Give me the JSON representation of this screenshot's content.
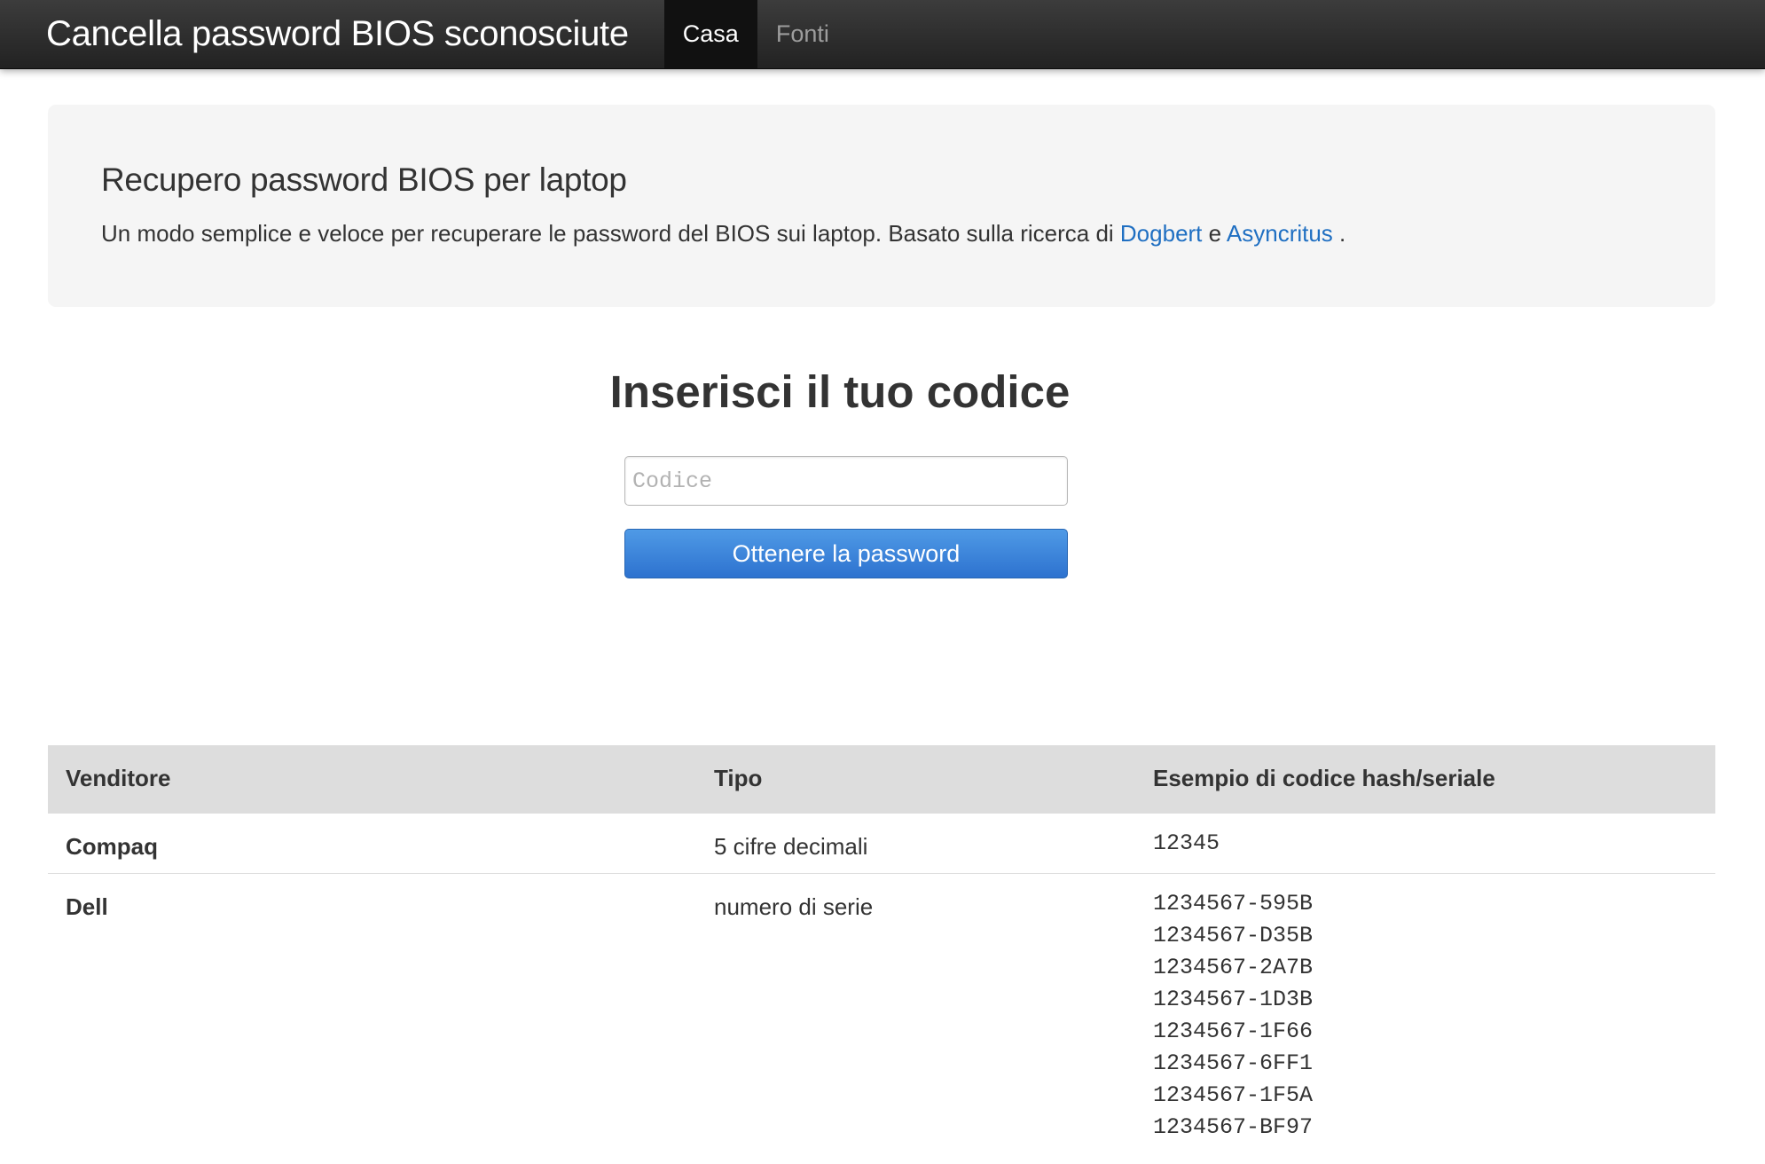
{
  "navbar": {
    "brand": "Cancella password BIOS sconosciute",
    "items": [
      {
        "label": "Casa",
        "active": true
      },
      {
        "label": "Fonti",
        "active": false
      }
    ]
  },
  "hero": {
    "title": "Recupero password BIOS per laptop",
    "text_before": "Un modo semplice e veloce per recuperare le password del BIOS sui laptop. Basato sulla ricerca di ",
    "link1": "Dogbert",
    "text_between": " e ",
    "link2": "Asyncritus",
    "text_after": " .",
    "link_color": "#1f6fc2"
  },
  "form": {
    "heading": "Inserisci il tuo codice",
    "input_placeholder": "Codice",
    "input_value": "",
    "button_label": "Ottenere la password",
    "button_color": "#3a82d9"
  },
  "table": {
    "headers": [
      "Venditore",
      "Tipo",
      "Esempio di codice hash/seriale"
    ],
    "rows": [
      {
        "vendor": "Compaq",
        "type": "5 cifre decimali",
        "codes": [
          "12345"
        ]
      },
      {
        "vendor": "Dell",
        "type": "numero di serie",
        "codes": [
          "1234567-595B",
          "1234567-D35B",
          "1234567-2A7B",
          "1234567-1D3B",
          "1234567-1F66",
          "1234567-6FF1",
          "1234567-1F5A",
          "1234567-BF97"
        ]
      }
    ]
  }
}
